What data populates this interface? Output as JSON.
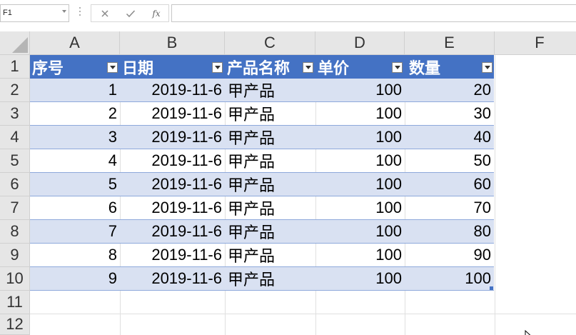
{
  "formula_bar": {
    "name_box": "F1",
    "formula": "",
    "cancel_icon": "x-icon",
    "enter_icon": "checkmark-icon",
    "fx_label": "fx"
  },
  "columns": [
    "A",
    "B",
    "C",
    "D",
    "E",
    "F"
  ],
  "rows": [
    "1",
    "2",
    "3",
    "4",
    "5",
    "6",
    "7",
    "8",
    "9",
    "10",
    "11",
    "12"
  ],
  "table": {
    "header_color": "#4472c4",
    "band_color": "#d9e1f2",
    "headers": [
      "序号",
      "日期",
      "产品名称",
      "单价",
      "数量"
    ],
    "records": [
      {
        "no": "1",
        "date": "2019-11-6",
        "product": "甲产品",
        "price": "100",
        "qty": "20"
      },
      {
        "no": "2",
        "date": "2019-11-6",
        "product": "甲产品",
        "price": "100",
        "qty": "30"
      },
      {
        "no": "3",
        "date": "2019-11-6",
        "product": "甲产品",
        "price": "100",
        "qty": "40"
      },
      {
        "no": "4",
        "date": "2019-11-6",
        "product": "甲产品",
        "price": "100",
        "qty": "50"
      },
      {
        "no": "5",
        "date": "2019-11-6",
        "product": "甲产品",
        "price": "100",
        "qty": "60"
      },
      {
        "no": "6",
        "date": "2019-11-6",
        "product": "甲产品",
        "price": "100",
        "qty": "70"
      },
      {
        "no": "7",
        "date": "2019-11-6",
        "product": "甲产品",
        "price": "100",
        "qty": "80"
      },
      {
        "no": "8",
        "date": "2019-11-6",
        "product": "甲产品",
        "price": "100",
        "qty": "90"
      },
      {
        "no": "9",
        "date": "2019-11-6",
        "product": "甲产品",
        "price": "100",
        "qty": "100"
      }
    ]
  }
}
